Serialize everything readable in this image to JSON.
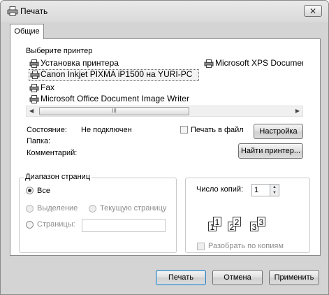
{
  "window": {
    "title": "Печать",
    "close_glyph": "✕"
  },
  "tabs": [
    {
      "label": "Общие"
    }
  ],
  "printer_group": {
    "label": "Выберите принтер",
    "printers": [
      {
        "name": "Установка принтера",
        "icon": "add-printer-icon"
      },
      {
        "name": "Microsoft XPS Documen",
        "icon": "printer-icon"
      },
      {
        "name": "Canon Inkjet PIXMA iP1500 на YURI-PC",
        "icon": "printer-icon",
        "selected": true
      },
      {
        "name": "Fax",
        "icon": "fax-icon"
      },
      {
        "name": "Microsoft Office Document Image Writer",
        "icon": "printer-icon"
      }
    ],
    "scroll_grip": "III",
    "status_label": "Состояние:",
    "status_value": "Не подключен",
    "folder_label": "Папка:",
    "comment_label": "Комментарий:",
    "print_to_file_label": "Печать в файл",
    "print_to_file_checked": false,
    "settings_button": "Настройка",
    "find_printer_button": "Найти принтер..."
  },
  "page_range": {
    "label": "Диапазон страниц",
    "all": "Все",
    "selection": "Выделение",
    "current_page": "Текущую страницу",
    "pages": "Страницы:",
    "pages_value": "",
    "selected_option": "all"
  },
  "copies": {
    "label": "Число копий:",
    "value": "1",
    "collate_label": "Разобрать по копиям",
    "collate_checked": false,
    "pages": [
      "1",
      "1",
      "2",
      "2",
      "3",
      "3"
    ]
  },
  "footer": {
    "print_button": "Печать",
    "cancel_button": "Отмена",
    "apply_button": "Применить"
  }
}
